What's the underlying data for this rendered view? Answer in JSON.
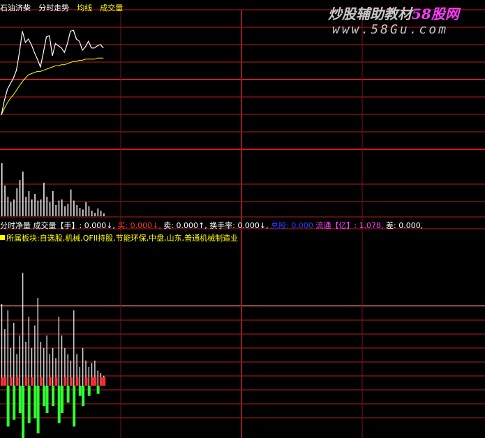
{
  "header": {
    "stock_name": "石油济柴",
    "indicators": [
      {
        "label": "分时走势",
        "color": "#ffffff"
      },
      {
        "label": "均线",
        "color": "#ffff00"
      },
      {
        "label": "成交量",
        "color": "#ffff00"
      }
    ]
  },
  "watermark": {
    "line1_a": "炒股辅助教材",
    "line1_b": "58股网",
    "line2": "www.58Gu.com",
    "color_a": "#c8c8c8",
    "color_b": "#ff3cff"
  },
  "info_row": {
    "items": [
      {
        "text": "分时净量",
        "color": "#ffffff"
      },
      {
        "text": " 成交量【手】: 0.000↓,",
        "color": "#ffffff"
      },
      {
        "text": " 买: 0.000↓,",
        "color": "#ff3030"
      },
      {
        "text": " 卖: 0.000↑,",
        "color": "#ffffff"
      },
      {
        "text": " 换手率: 0.000↓,",
        "color": "#ffffff"
      },
      {
        "text": " 总股: 0.000",
        "color": "#3838ff"
      },
      {
        "text": " 流通【亿】: 1.078,",
        "color": "#ff40ff"
      },
      {
        "text": " 差: 0.000,",
        "color": "#ffffff"
      }
    ]
  },
  "sector_row": {
    "label": "所属板块:",
    "value": "自选股,机械,QFII持股,节能环保,中盘,山东,普通机械制造业",
    "color": "#ffff00"
  },
  "chart_data": {
    "type": "line",
    "price_series": [
      0.22,
      0.35,
      0.45,
      0.5,
      0.55,
      0.62,
      0.78,
      0.97,
      0.87,
      0.9,
      0.85,
      0.78,
      0.72,
      0.65,
      0.78,
      0.92,
      0.93,
      0.75,
      0.86,
      0.84,
      0.82,
      0.78,
      0.86,
      0.97,
      0.98,
      0.9,
      0.88,
      0.8,
      0.83,
      0.88,
      0.82,
      0.82,
      0.84,
      0.85,
      0.82
    ],
    "avg_series": [
      0.22,
      0.28,
      0.33,
      0.37,
      0.4,
      0.44,
      0.48,
      0.52,
      0.55,
      0.58,
      0.59,
      0.6,
      0.61,
      0.61,
      0.62,
      0.63,
      0.64,
      0.65,
      0.66,
      0.66,
      0.67,
      0.67,
      0.68,
      0.69,
      0.7,
      0.7,
      0.71,
      0.71,
      0.72,
      0.72,
      0.72,
      0.72,
      0.73,
      0.73,
      0.73
    ],
    "volume_series": [
      0.95,
      0.55,
      0.35,
      0.25,
      0.3,
      0.5,
      0.65,
      0.8,
      0.35,
      0.45,
      0.3,
      0.4,
      0.28,
      0.3,
      0.6,
      0.35,
      0.25,
      0.45,
      0.2,
      0.28,
      0.3,
      0.18,
      0.22,
      0.48,
      0.28,
      0.2,
      0.15,
      0.12,
      0.25,
      0.18,
      0.1,
      0.06,
      0.14,
      0.1,
      0.05
    ],
    "net_volume_series": [
      0.65,
      0.45,
      0.6,
      0.3,
      0.5,
      0.25,
      0.4,
      0.9,
      0.35,
      0.55,
      0.3,
      0.48,
      0.7,
      0.35,
      0.3,
      0.4,
      0.25,
      0.3,
      0.22,
      0.55,
      0.4,
      0.3,
      0.25,
      0.2,
      0.6,
      0.25,
      0.15,
      0.3,
      0.2,
      0.15,
      0.18,
      0.2,
      0.12,
      0.1,
      0.08
    ],
    "net_sign": [
      1,
      1,
      -1,
      1,
      -1,
      1,
      -1,
      -1,
      1,
      -1,
      1,
      -1,
      -1,
      1,
      -1,
      -1,
      1,
      -1,
      1,
      -1,
      -1,
      1,
      -1,
      1,
      -1,
      1,
      -1,
      -1,
      1,
      -1,
      1,
      1,
      -1,
      1,
      1
    ],
    "colors": {
      "price": "#ffffff",
      "avg": "#ffff00",
      "volume": "#ffffff",
      "net_up": "#ff3030",
      "net_down": "#30ff30",
      "grid_h": "#b41e1e",
      "grid_v": "#7a1414",
      "grid_v_mid": "#a01818",
      "grid_thick": "#c81e1e"
    }
  }
}
